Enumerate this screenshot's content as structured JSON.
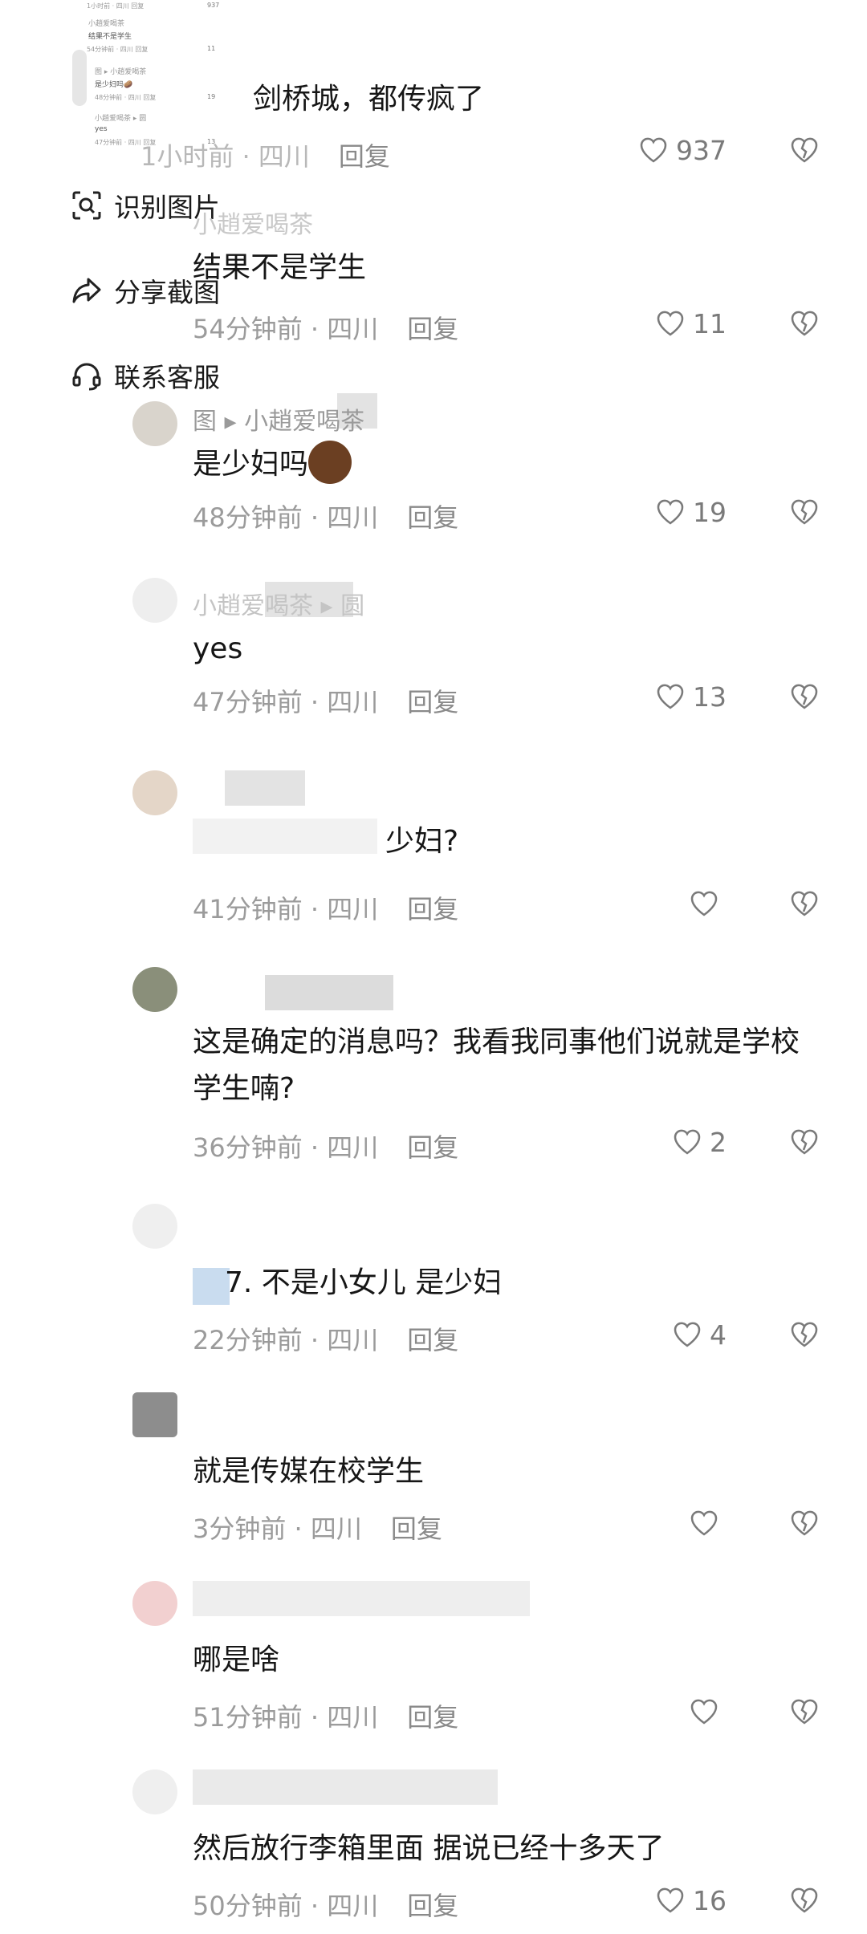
{
  "thumbnail": {
    "rows": [
      {
        "meta": "1小时前 · 四川  回复",
        "likes": "937"
      },
      {
        "name": "小趙爱喝茶",
        "text": "结果不是学生",
        "meta": "54分钟前 · 四川  回复",
        "likes": "11"
      },
      {
        "name": "图 ▸ 小趙爱喝茶",
        "text": "是少妇吗🥔",
        "meta": "48分钟前 · 四川  回复",
        "likes": "19"
      },
      {
        "name": "小趙爱喝茶 ▸ 圆",
        "text": "yes",
        "meta": "47分钟前 · 四川  回复",
        "likes": "13"
      }
    ]
  },
  "context_menu": {
    "items": [
      {
        "label": "识别图片",
        "icon": "scan-icon"
      },
      {
        "label": "分享截图",
        "icon": "share-icon"
      },
      {
        "label": "联系客服",
        "icon": "headset-icon"
      }
    ]
  },
  "comments": [
    {
      "name": "",
      "text": "剑桥城，都传疯了",
      "time": "1小时前",
      "location": "四川",
      "reply": "回复",
      "likes": "937"
    },
    {
      "name": "小趙爱喝茶",
      "text": "结果不是学生",
      "time": "54分钟前",
      "location": "四川",
      "reply": "回复",
      "likes": "11"
    },
    {
      "name": "图 ▸ 小趙爱喝茶",
      "text": "是少妇吗",
      "time": "48分钟前",
      "location": "四川",
      "reply": "回复",
      "likes": "19"
    },
    {
      "name": "小趙爱喝茶 ▸ 圆",
      "text": "yes",
      "time": "47分钟前",
      "location": "四川",
      "reply": "回复",
      "likes": "13"
    },
    {
      "name": "",
      "text": "少妇?",
      "time": "41分钟前",
      "location": "四川",
      "reply": "回复",
      "likes": ""
    },
    {
      "name": "",
      "text": "这是确定的消息吗？我看我同事他们说就是学校学生喃?",
      "time": "36分钟前",
      "location": "四川",
      "reply": "回复",
      "likes": "2"
    },
    {
      "name": "",
      "text": "7. 不是小女儿 是少妇",
      "time": "22分钟前",
      "location": "四川",
      "reply": "回复",
      "likes": "4"
    },
    {
      "name": "",
      "text": "就是传媒在校学生",
      "time": "3分钟前",
      "location": "四川",
      "reply": "回复",
      "likes": ""
    },
    {
      "name": "",
      "text": "哪是啥",
      "time": "51分钟前",
      "location": "四川",
      "reply": "回复",
      "likes": ""
    },
    {
      "name": "",
      "text": "然后放行李箱里面  据说已经十多天了",
      "time": "50分钟前",
      "location": "四川",
      "reply": "回复",
      "likes": "16"
    }
  ]
}
